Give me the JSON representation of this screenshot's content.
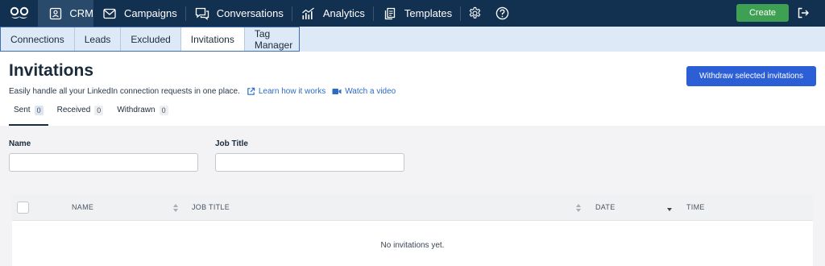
{
  "nav": {
    "items": [
      {
        "label": "CRM",
        "icon": "contact-card-icon"
      },
      {
        "label": "Campaigns",
        "icon": "envelope-icon"
      },
      {
        "label": "Conversations",
        "icon": "chat-bubbles-icon"
      },
      {
        "label": "Analytics",
        "icon": "chart-icon"
      },
      {
        "label": "Templates",
        "icon": "document-icon"
      }
    ],
    "create_label": "Create"
  },
  "subnav": {
    "items": [
      "Connections",
      "Leads",
      "Excluded",
      "Invitations",
      "Tag Manager"
    ],
    "active": "Invitations"
  },
  "page": {
    "title": "Invitations",
    "description": "Easily handle all your LinkedIn connection requests in one place.",
    "learn_link": "Learn how it works",
    "video_link": "Watch a video",
    "withdraw_label": "Withdraw selected invitations"
  },
  "tabs": [
    {
      "label": "Sent",
      "count": "0"
    },
    {
      "label": "Received",
      "count": "0"
    },
    {
      "label": "Withdrawn",
      "count": "0"
    }
  ],
  "filters": {
    "name_label": "Name",
    "name_value": "",
    "job_label": "Job Title",
    "job_value": ""
  },
  "table": {
    "columns": [
      "NAME",
      "JOB TITLE",
      "DATE",
      "TIME"
    ],
    "empty_text": "No invitations yet."
  },
  "colors": {
    "nav_bg": "#12304f",
    "create": "#3ea052",
    "primary": "#2c5fd6",
    "link": "#2d6bc4"
  }
}
